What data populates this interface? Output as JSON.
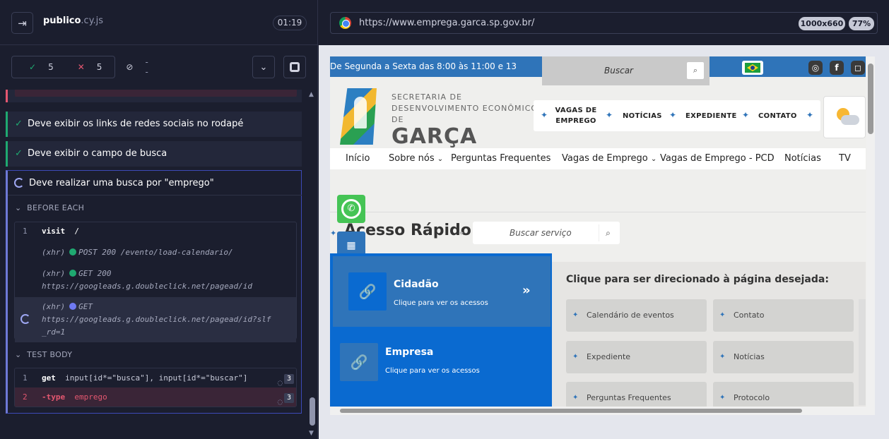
{
  "runner": {
    "spec_name": "publico",
    "spec_ext": ".cy.js",
    "elapsed": "01:19",
    "stats": {
      "passed": "5",
      "failed": "5",
      "pending": "--"
    },
    "tests": [
      {
        "title": "Deve exibir os links de redes sociais no rodapé"
      },
      {
        "title": "Deve exibir o campo de busca"
      }
    ],
    "active_test": {
      "title": "Deve realizar uma busca por \"emprego\"",
      "before_each_label": "BEFORE EACH",
      "test_body_label": "TEST BODY",
      "before_each": {
        "line1_num": "1",
        "line1_cmd": "visit",
        "line1_arg": "/",
        "xhr1_tag": "(xhr)",
        "xhr1_method": "POST 200",
        "xhr1_url": "/evento/load-calendario/",
        "xhr2_tag": "(xhr)",
        "xhr2_method": "GET 200",
        "xhr2_url": "https://googleads.g.doubleclick.net/pagead/id",
        "xhr3_tag": "(xhr)",
        "xhr3_method": "GET",
        "xhr3_url": "https://googleads.g.doubleclick.net/pagead/id?slf_rd=1"
      },
      "body": {
        "line1_num": "1",
        "line1_cmd": "get",
        "line1_arg": "input[id*=\"busca\"], input[id*=\"buscar\"]",
        "line1_count": "3",
        "line2_num": "2",
        "line2_cmd": "-type",
        "line2_arg": "emprego",
        "line2_count": "3"
      }
    }
  },
  "aut": {
    "url": "https://www.emprega.garca.sp.gov.br/",
    "viewport": "1000x660",
    "zoom": "77%"
  },
  "site": {
    "hours": "De Segunda a Sexta das 8:00 às 11:00 e 13",
    "search_placeholder": "Buscar",
    "secretaria_line1": "SECRETARIA DE",
    "secretaria_line2": "DESENVOLVIMENTO ECONÔMICO",
    "secretaria_line3": "DE",
    "city": "GARÇA",
    "topnav": [
      "VAGAS DE EMPREGO",
      "NOTÍCIAS",
      "EXPEDIENTE",
      "CONTATO"
    ],
    "mainnav": [
      "Início",
      "Sobre nós",
      "Perguntas Frequentes",
      "Vagas de Emprego",
      "Vagas de Emprego - PCD",
      "Notícias",
      "TV"
    ],
    "acesso_title": "Acesso Rápido",
    "service_placeholder": "Buscar serviço",
    "cards": [
      {
        "title": "Cidadão",
        "subtitle": "Clique para ver os acessos"
      },
      {
        "title": "Empresa",
        "subtitle": "Clique para ver os acessos"
      }
    ],
    "panel_title": "Clique para ser direcionado à página desejada:",
    "quick_links": [
      "Calendário de eventos",
      "Contato",
      "Expediente",
      "Notícias",
      "Perguntas Frequentes",
      "Protocolo"
    ]
  }
}
